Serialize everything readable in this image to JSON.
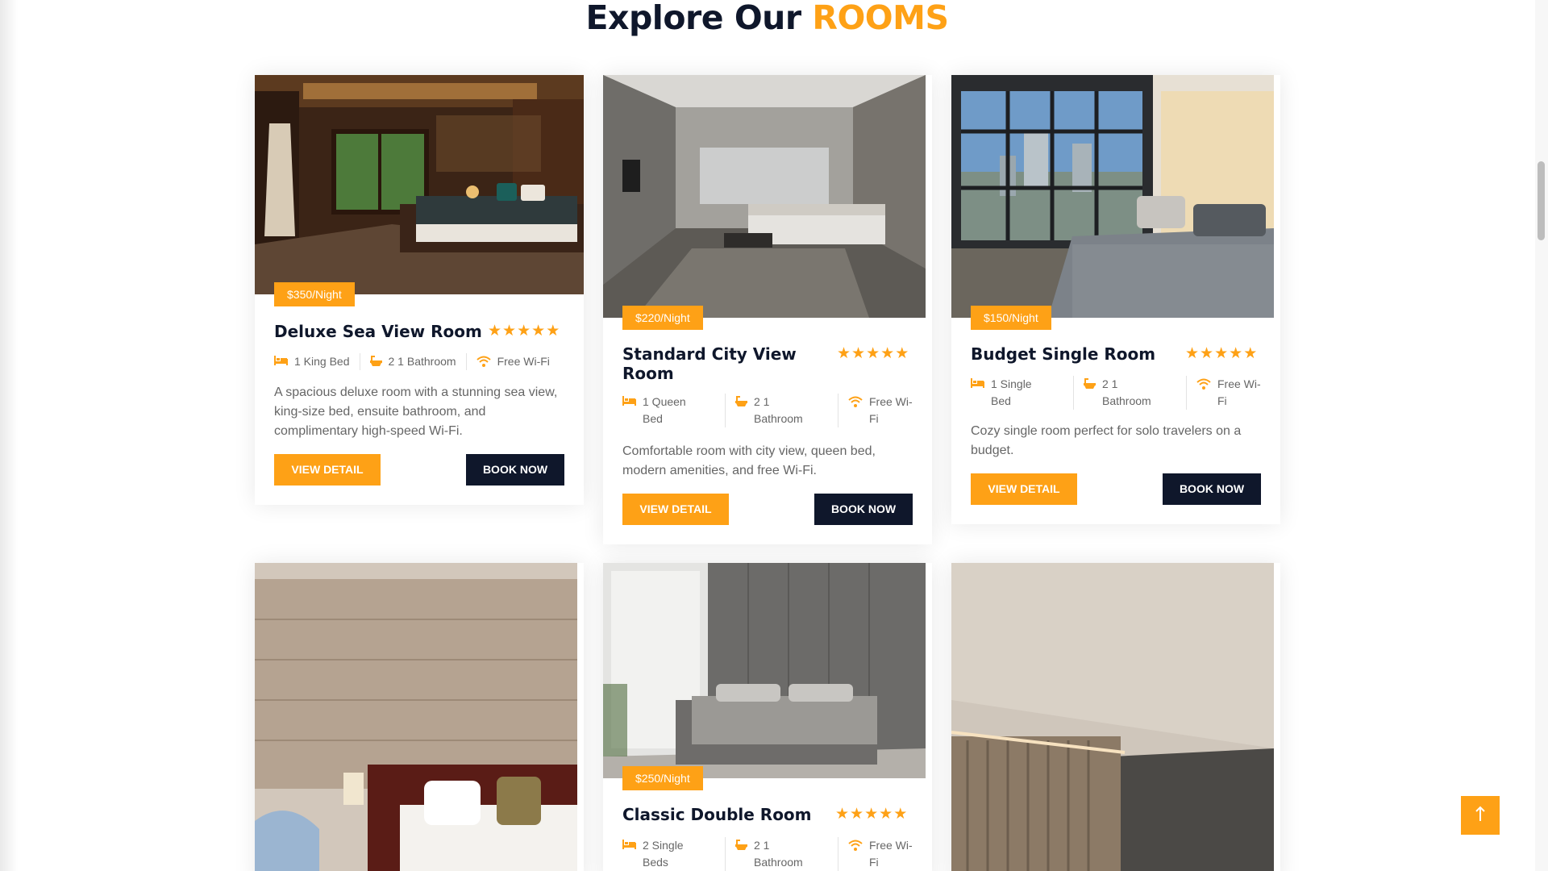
{
  "section": {
    "title_prefix": "Explore Our",
    "title_accent": "ROOMS"
  },
  "colors": {
    "accent": "#fea116",
    "dark": "#0f172b"
  },
  "rooms": [
    {
      "price": "$350/Night",
      "title": "Deluxe Sea View Room",
      "rating": 5,
      "amenities": [
        {
          "icon": "bed-icon",
          "text": "1 King Bed"
        },
        {
          "icon": "bath-icon",
          "text": "2 1 Bathroom"
        },
        {
          "icon": "wifi-icon",
          "text": "Free Wi-Fi"
        }
      ],
      "description": "A spacious deluxe room with a stunning sea view, king-size bed, ensuite bathroom, and complimentary high-speed Wi-Fi.",
      "view_label": "VIEW DETAIL",
      "book_label": "BOOK NOW"
    },
    {
      "price": "$220/Night",
      "title": "Standard City View Room",
      "rating": 5,
      "amenities": [
        {
          "icon": "bed-icon",
          "text": "1 Queen Bed"
        },
        {
          "icon": "bath-icon",
          "text": "2 1 Bathroom"
        },
        {
          "icon": "wifi-icon",
          "text": "Free Wi-Fi"
        }
      ],
      "description": "Comfortable room with city view, queen bed, modern amenities, and free Wi-Fi.",
      "view_label": "VIEW DETAIL",
      "book_label": "BOOK NOW"
    },
    {
      "price": "$150/Night",
      "title": "Budget Single Room",
      "rating": 5,
      "amenities": [
        {
          "icon": "bed-icon",
          "text": "1 Single Bed"
        },
        {
          "icon": "bath-icon",
          "text": "2 1 Bathroom"
        },
        {
          "icon": "wifi-icon",
          "text": "Free Wi-Fi"
        }
      ],
      "description": "Cozy single room perfect for solo travelers on a budget.",
      "view_label": "VIEW DETAIL",
      "book_label": "BOOK NOW"
    },
    {
      "price": "$250/Night",
      "title": "Classic Double Room",
      "rating": 5,
      "amenities": [
        {
          "icon": "bed-icon",
          "text": "2 Single Beds"
        },
        {
          "icon": "bath-icon",
          "text": "2 1 Bathroom"
        },
        {
          "icon": "wifi-icon",
          "text": "Free Wi-Fi"
        }
      ]
    }
  ],
  "back_to_top": {
    "icon": "arrow-up-icon"
  }
}
